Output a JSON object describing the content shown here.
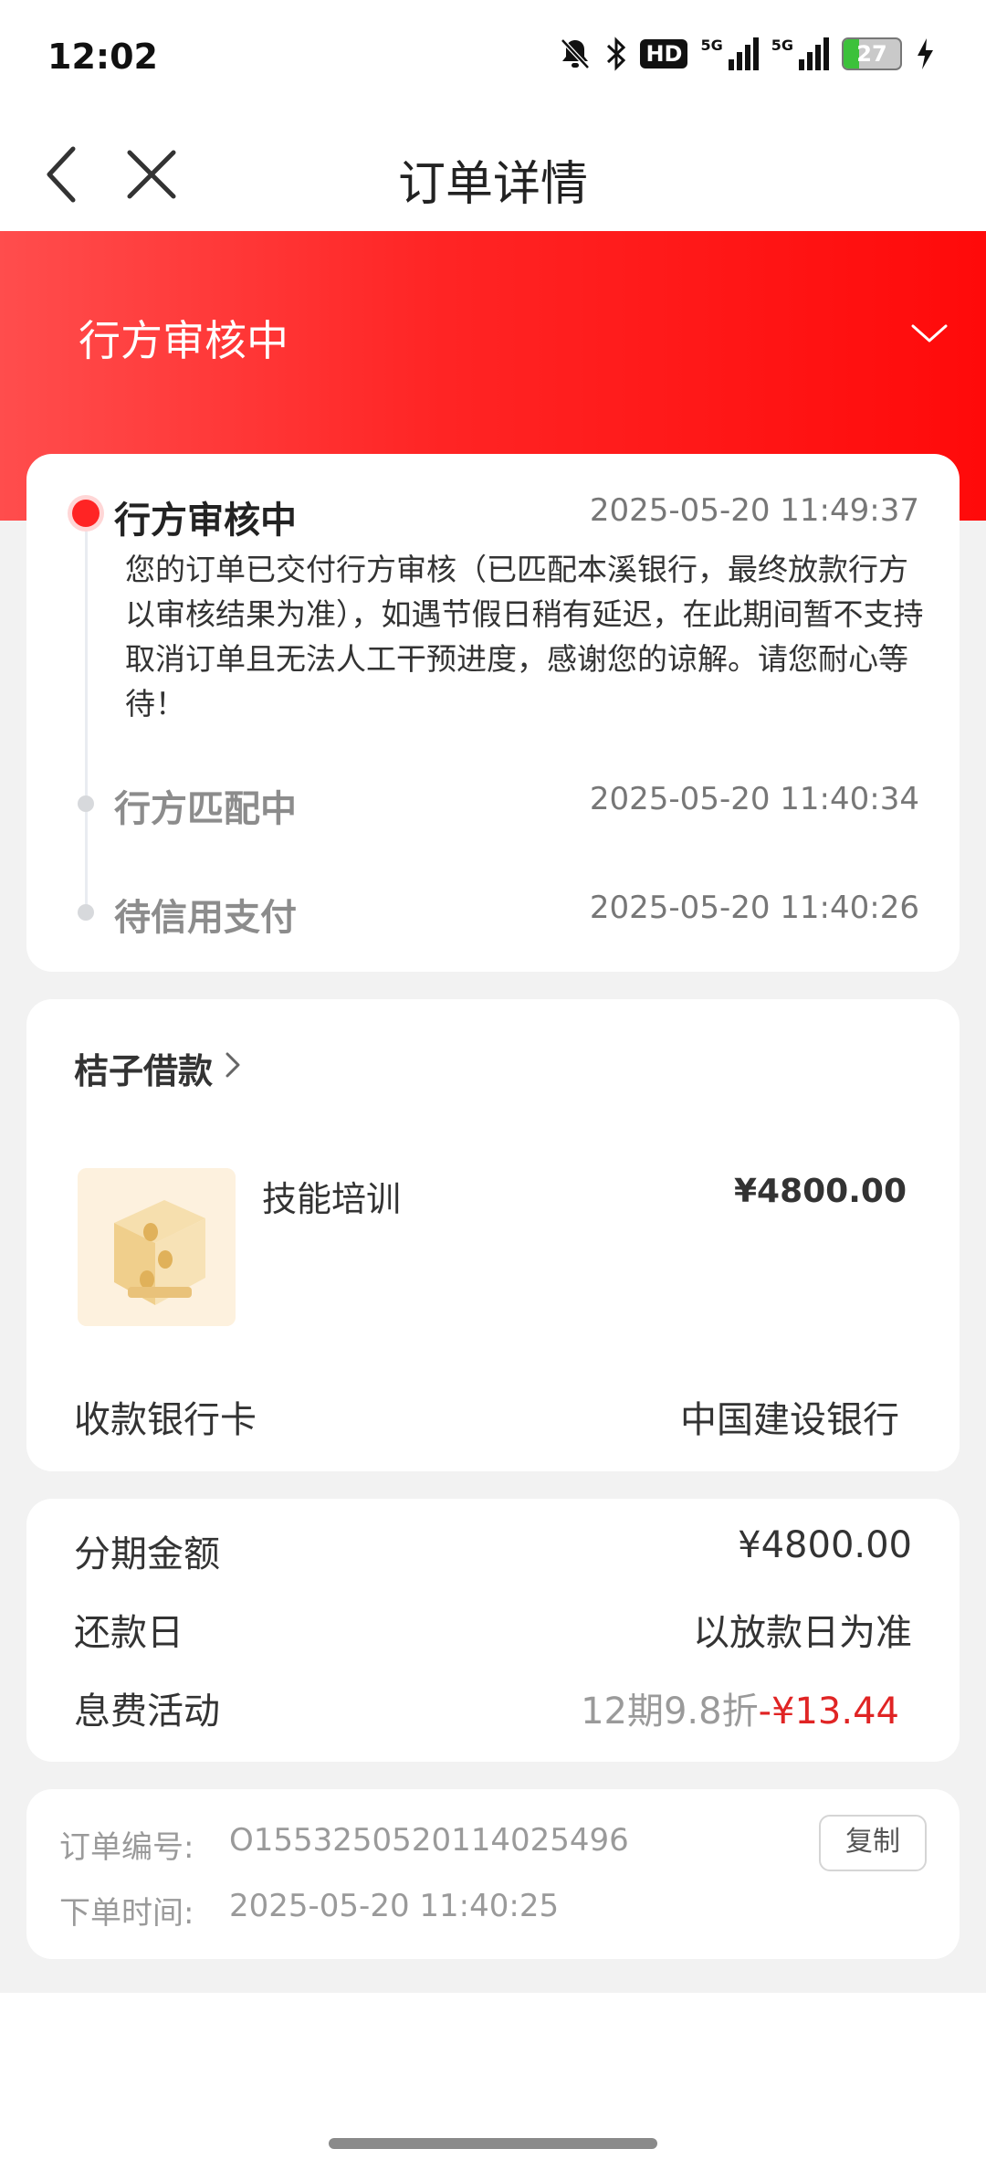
{
  "status_bar": {
    "time": "12:02",
    "hd": "HD",
    "net1": "5G",
    "net2": "5G",
    "battery": "27"
  },
  "navbar": {
    "title": "订单详情"
  },
  "hero": {
    "status_title": "行方审核中"
  },
  "timeline": [
    {
      "title": "行方审核中",
      "time": "2025-05-20 11:49:37",
      "desc": "您的订单已交付行方审核（已匹配本溪银行，最终放款行方以审核结果为准），如遇节假日稍有延迟，在此期间暂不支持取消订单且无法人工干预进度，感谢您的谅解。请您耐心等待！"
    },
    {
      "title": "行方匹配中",
      "time": "2025-05-20 11:40:34"
    },
    {
      "title": "待信用支付",
      "time": "2025-05-20 11:40:26"
    }
  ],
  "merchant": {
    "name": "桔子借款",
    "product_name": "技能培训",
    "product_price": "¥4800.00",
    "bank_label": "收款银行卡",
    "bank_value": "中国建设银行"
  },
  "installment": {
    "amount_label": "分期金额",
    "amount_value": "¥4800.00",
    "repay_label": "还款日",
    "repay_value": "以放款日为准",
    "promo_label": "息费活动",
    "promo_text": "12期9.8折",
    "promo_discount": "-¥13.44"
  },
  "order_meta": {
    "no_label": "订单编号:",
    "no_value": "O1553250520114025496",
    "time_label": "下单时间:",
    "time_value": "2025-05-20 11:40:25",
    "copy_label": "复制"
  },
  "colors": {
    "accent_red": "#ff2424",
    "discount_red": "#e02424",
    "page_gray": "#f2f2f2"
  }
}
